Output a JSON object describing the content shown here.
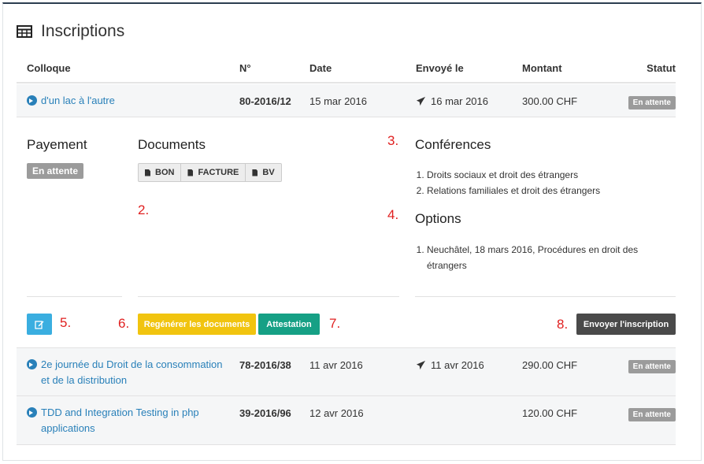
{
  "title": "Inscriptions",
  "columns": {
    "colloque": "Colloque",
    "numero": "N°",
    "date": "Date",
    "envoye": "Envoyé le",
    "montant": "Montant",
    "statut": "Statut"
  },
  "rows": [
    {
      "colloque": "d'un lac à l'autre",
      "numero": "80-2016/12",
      "date": "15 mar 2016",
      "envoye": "16 mar 2016",
      "montant": "300.00 CHF",
      "statut": "En attente"
    },
    {
      "colloque": "2e journée du Droit de la consommation et de la distribution",
      "numero": "78-2016/38",
      "date": "11 avr 2016",
      "envoye": "11 avr 2016",
      "montant": "290.00 CHF",
      "statut": "En attente"
    },
    {
      "colloque": "TDD and Integration Testing in php applications",
      "numero": "39-2016/96",
      "date": "12 avr 2016",
      "envoye": "",
      "montant": "120.00 CHF",
      "statut": "En attente"
    }
  ],
  "detail": {
    "payement_title": "Payement",
    "payement_status": "En attente",
    "documents_title": "Documents",
    "documents": [
      "BON",
      "FACTURE",
      "BV"
    ],
    "conferences_title": "Conférences",
    "conferences": [
      "Droits sociaux et droit des étrangers",
      "Relations familiales et droit des étrangers"
    ],
    "options_title": "Options",
    "options": [
      "Neuchâtel, 18 mars 2016, Procédures en droit des étrangers"
    ],
    "actions": {
      "regenerate": "Regénérer les documents",
      "attestation": "Attestation",
      "send": "Envoyer l'inscription"
    },
    "annotations": [
      "2.",
      "3.",
      "4.",
      "5.",
      "6.",
      "7.",
      "8."
    ]
  },
  "colors": {
    "link": "#2980b9",
    "badge": "#9b9b9b",
    "edit_button": "#3aaee0",
    "regenerate_button": "#f1c40f",
    "attestation_button": "#16a085",
    "send_button": "#4a4a4a",
    "annotation": "#e02020"
  },
  "icons": [
    "table-icon",
    "circle-arrow-right-icon",
    "paper-plane-icon",
    "file-icon",
    "edit-icon"
  ]
}
